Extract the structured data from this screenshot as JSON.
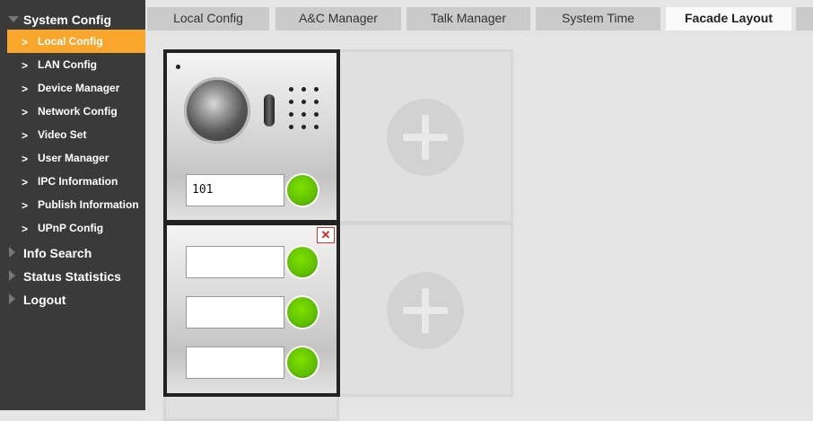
{
  "sidebar": {
    "sections": [
      {
        "label": "System Config",
        "expanded": true
      },
      {
        "label": "Info Search",
        "expanded": false
      },
      {
        "label": "Status Statistics",
        "expanded": false
      },
      {
        "label": "Logout",
        "expanded": false
      }
    ],
    "items": [
      {
        "label": "Local Config",
        "active": true
      },
      {
        "label": "LAN Config"
      },
      {
        "label": "Device Manager"
      },
      {
        "label": "Network Config"
      },
      {
        "label": "Video Set"
      },
      {
        "label": "User Manager"
      },
      {
        "label": "IPC Information"
      },
      {
        "label": "Publish Information"
      },
      {
        "label": "UPnP Config"
      }
    ],
    "active_color": "#f8a62c"
  },
  "tabs": [
    {
      "label": "Local Config"
    },
    {
      "label": "A&C Manager"
    },
    {
      "label": "Talk Manager"
    },
    {
      "label": "System Time"
    },
    {
      "label": "Facade Layout",
      "active": true
    }
  ],
  "facade": {
    "camera_module": {
      "name_value": "101"
    },
    "button_module": {
      "name_values": [
        "",
        "",
        ""
      ],
      "delete_label": "✕"
    },
    "button_color": "#66cc00"
  }
}
